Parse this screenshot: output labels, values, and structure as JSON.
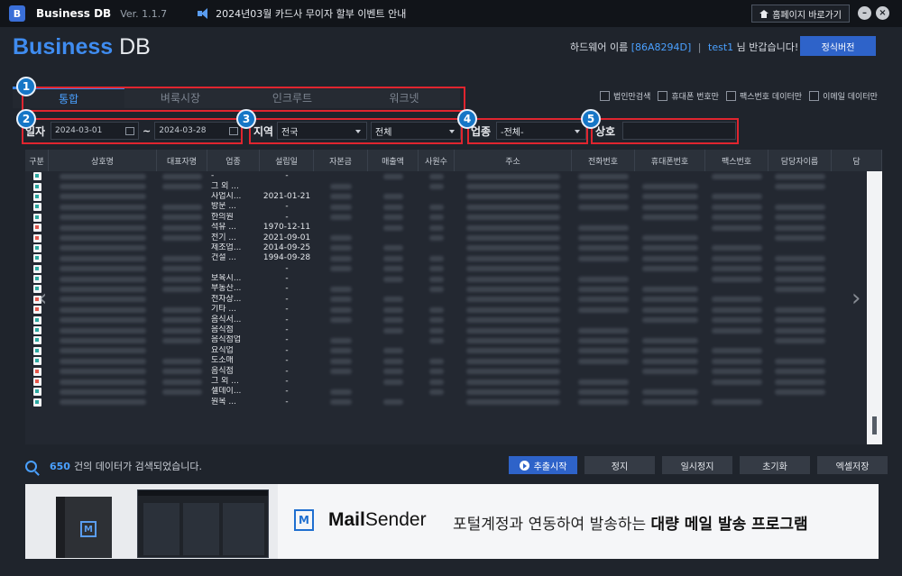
{
  "titlebar": {
    "logo_letter": "B",
    "app_name": "Business DB",
    "version": "Ver. 1.1.7",
    "notice": "2024년03월 카드사 무이자 할부 이벤트 안내",
    "home_button": "홈페이지 바로가기",
    "minimize": "–",
    "close": "×"
  },
  "header": {
    "brand_1": "Business",
    "brand_2": "DB",
    "user_prefix": "하드웨어 이름",
    "hw_id": "[86A8294D]",
    "sep": "|",
    "username": "test1",
    "user_suffix": "님 반갑습니다!",
    "official_button": "정식버전"
  },
  "tabs": [
    {
      "label": "통합",
      "active": true
    },
    {
      "label": "벼룩시장",
      "active": false
    },
    {
      "label": "인크루트",
      "active": false
    },
    {
      "label": "워크넷",
      "active": false
    }
  ],
  "checkboxes": [
    {
      "label": "법인만검색"
    },
    {
      "label": "휴대폰 번호만"
    },
    {
      "label": "팩스번호 데이터만"
    },
    {
      "label": "이메일 데이터만"
    }
  ],
  "badges": [
    "1",
    "2",
    "3",
    "4",
    "5"
  ],
  "filters": {
    "date_label": "일자",
    "date_from": "2024-03-01",
    "tilde": "~",
    "date_to": "2024-03-28",
    "region_label": "지역",
    "region_value": "전국",
    "subregion_value": "전체",
    "industry_label": "업종",
    "industry_value": "-전체-",
    "name_label": "상호"
  },
  "grid": {
    "columns": [
      "구분",
      "상호명",
      "대표자명",
      "업종",
      "설립일",
      "자본금",
      "매출액",
      "사원수",
      "주소",
      "전화번호",
      "휴대폰번호",
      "팩스번호",
      "담당자이름",
      "담"
    ],
    "rows": [
      {
        "industry": "-",
        "date": "-"
      },
      {
        "industry": "그 외 ...",
        "date": ""
      },
      {
        "industry": "사업시...",
        "date": "2021-01-21"
      },
      {
        "industry": "방문 ...",
        "date": "-"
      },
      {
        "industry": "한의원",
        "date": "-"
      },
      {
        "industry": "석유 ...",
        "date": "1970-12-11"
      },
      {
        "industry": "전기 ...",
        "date": "2021-09-01"
      },
      {
        "industry": "제조업...",
        "date": "2014-09-25"
      },
      {
        "industry": "건설 ...",
        "date": "1994-09-28"
      },
      {
        "industry": "",
        "date": "-"
      },
      {
        "industry": "보육시...",
        "date": "-"
      },
      {
        "industry": "부동산...",
        "date": "-"
      },
      {
        "industry": "전자상...",
        "date": "-"
      },
      {
        "industry": "기타 ...",
        "date": "-"
      },
      {
        "industry": "음식서...",
        "date": "-"
      },
      {
        "industry": "음식점",
        "date": "-"
      },
      {
        "industry": "음식점업",
        "date": "-"
      },
      {
        "industry": "요식업",
        "date": "-"
      },
      {
        "industry": "도소매",
        "date": "-"
      },
      {
        "industry": "음식점",
        "date": "-"
      },
      {
        "industry": "그 외 ...",
        "date": "-"
      },
      {
        "industry": "셀데이...",
        "date": "-"
      },
      {
        "industry": "원목 ...",
        "date": "-"
      }
    ],
    "prev_arrow": "‹",
    "next_arrow": "›"
  },
  "status": {
    "count": "650",
    "text": "건의 데이터가 검색되었습니다."
  },
  "actions": {
    "start": "추출시작",
    "stop": "정지",
    "pause": "일시정지",
    "reset": "초기화",
    "excel": "엑셀저장"
  },
  "banner": {
    "product_mark": "M",
    "mail_logo": "M",
    "mail_name_1": "Mail",
    "mail_name_2": "Sender",
    "slogan_1": "포털계정과 연동하여 발송하는",
    "slogan_2": "대량 메일 발송 프로그램"
  }
}
